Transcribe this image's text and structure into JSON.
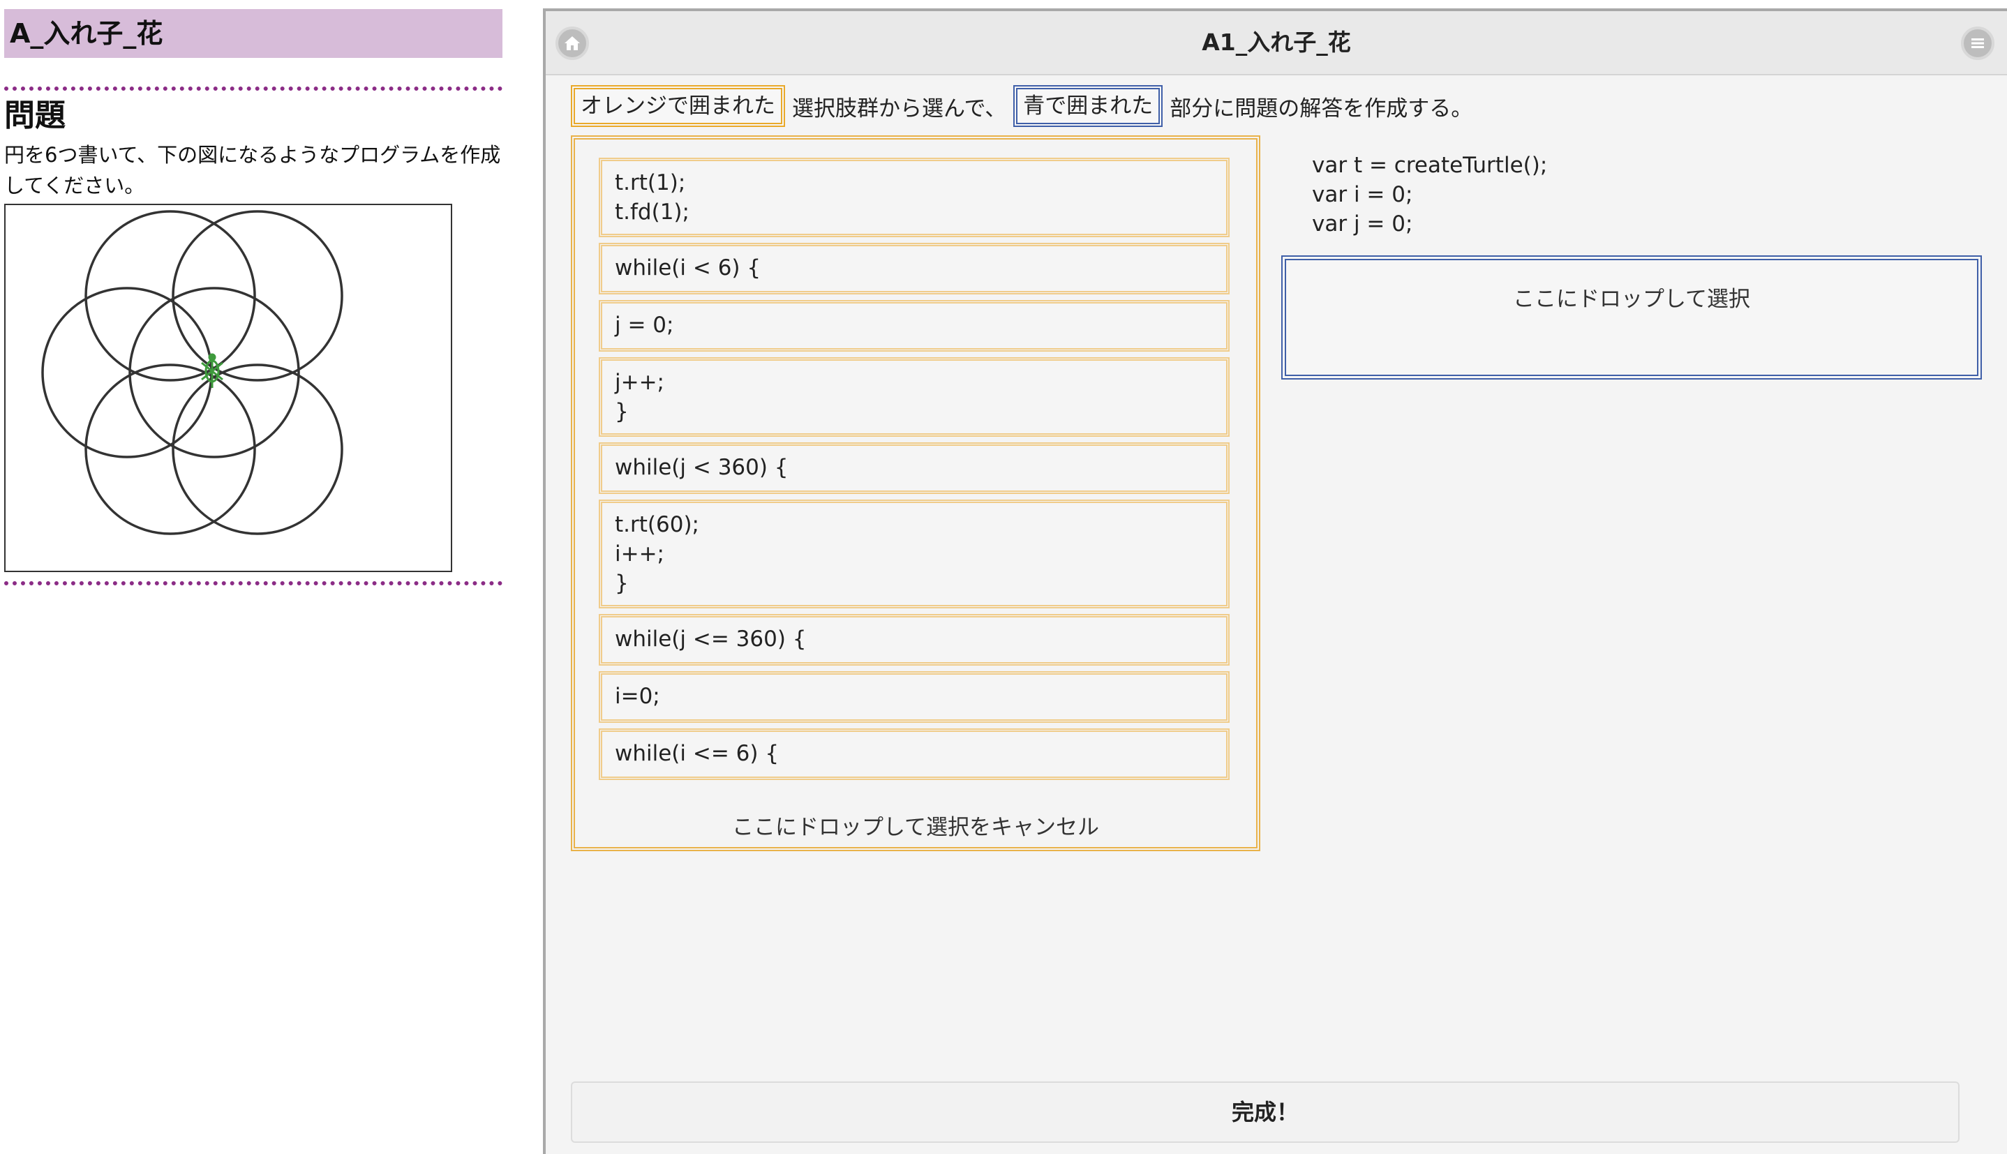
{
  "left": {
    "title": "A_入れ子_花",
    "heading": "問題",
    "text": "円を6つ書いて、下の図になるようなプログラムを作成してください。"
  },
  "header": {
    "title": "A1_入れ子_花",
    "home_icon": "home-icon",
    "menu_icon": "menu-icon"
  },
  "instruction": {
    "orange_tag": "オレンジで囲まれた",
    "middle": "選択肢群から選んで、",
    "blue_tag": "青で囲まれた",
    "end": "部分に問題の解答を作成する。"
  },
  "choices": [
    "t.rt(1);\nt.fd(1);",
    "while(i < 6) {",
    "j = 0;",
    "j++;\n}",
    "while(j < 360) {",
    "t.rt(60);\ni++;\n}",
    "while(j <= 360) {",
    "i=0;",
    "while(i <= 6) {"
  ],
  "choices_cancel_label": "ここにドロップして選択をキャンセル",
  "preset_code": "var t = createTurtle();\nvar i = 0;\nvar j = 0;",
  "answer_area": {
    "drop_label": "ここにドロップして選択"
  },
  "complete_button": "完成！",
  "colors": {
    "title_bg": "#d7bcd9",
    "dotted_rule": "#8b2c86",
    "orange_border": "#e9b24a",
    "blue_border": "#3f5fa8",
    "turtle_green": "#3e9a3c"
  }
}
